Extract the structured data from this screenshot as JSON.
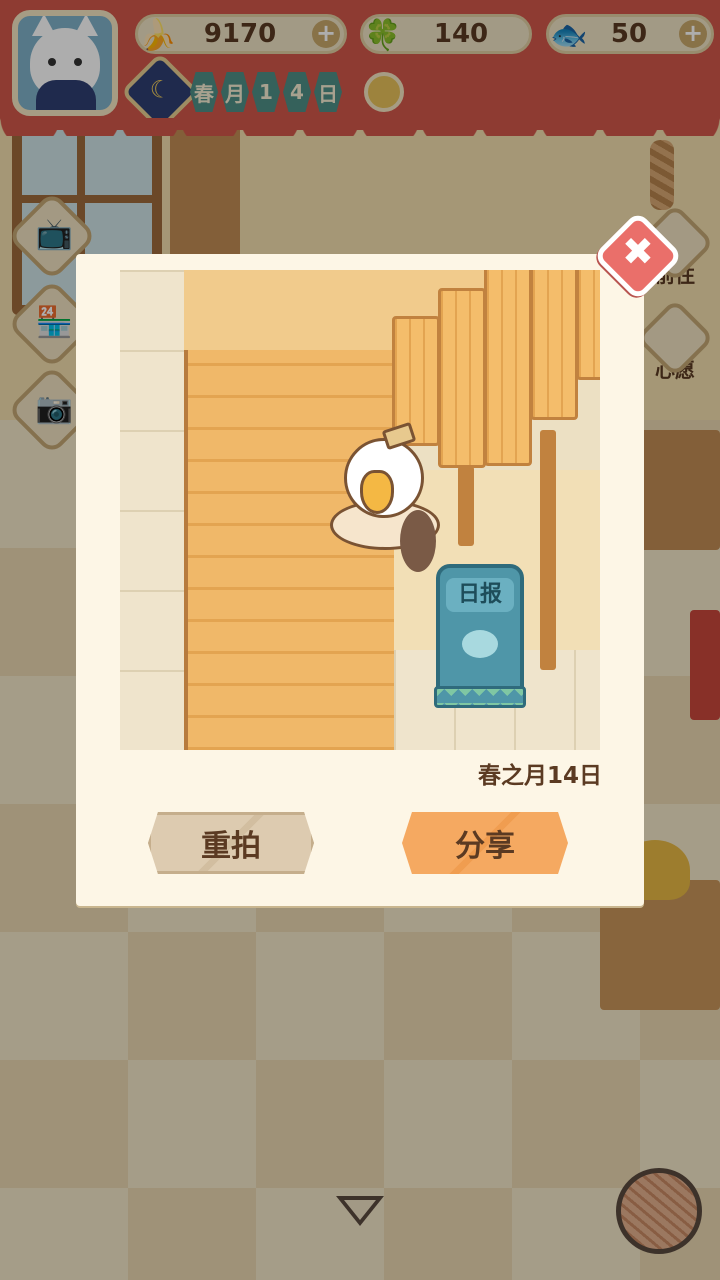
{
  "hud": {
    "banana": {
      "value": "9170",
      "icon": "banana-icon"
    },
    "clover": {
      "value": "140",
      "icon": "clover-icon"
    },
    "fish": {
      "value": "50",
      "icon": "fish-icon"
    },
    "plus": "+",
    "date_chars": [
      "春",
      "月",
      "1",
      "4",
      "日"
    ]
  },
  "side": {
    "goto_label": "前往",
    "wish_label": "心愿"
  },
  "dialog": {
    "photo_sign": "日报",
    "photo_date": "春之月14日",
    "retake_label": "重拍",
    "share_label": "分享",
    "close_glyph": "✖"
  },
  "colors": {
    "hud_red": "#d2574a",
    "share_orange": "#f5a961",
    "retake_beige": "#ddcbb0",
    "close_red": "#ea6f6a",
    "dialog_bg": "#fdf6e6"
  }
}
